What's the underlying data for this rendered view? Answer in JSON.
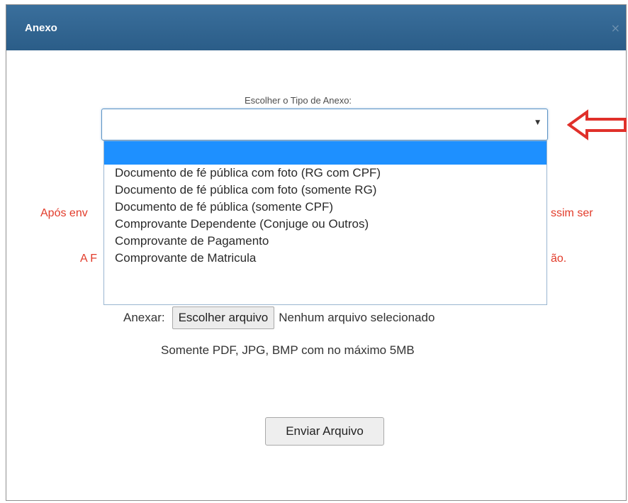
{
  "dialog": {
    "title": "Anexo",
    "close_glyph": "×",
    "close_icon": "close-icon"
  },
  "attachment_type": {
    "label": "Escolher o Tipo de Anexo:",
    "selected_value": "",
    "caret_glyph": "▼",
    "caret_icon": "chevron-down-icon",
    "options": [
      "",
      "Documento de fé pública com foto (RG com CPF)",
      "Documento de fé pública com foto (somente RG)",
      "Documento de fé pública (somente CPF)",
      "Comprovante Dependente (Conjuge ou Outros)",
      "Comprovante de Pagamento",
      "Comprovante de Matricula"
    ],
    "highlighted_option_index": 0
  },
  "annotation": {
    "arrow_icon": "left-arrow-icon",
    "arrow_color": "#e0302a"
  },
  "warnings": {
    "line1_start": "Após env",
    "line1_end": "ssim ser",
    "line2_start": "A F",
    "line2_end": "ão."
  },
  "file_upload": {
    "label": "Anexar:",
    "button_label": "Escolher arquivo",
    "status": "Nenhum arquivo selecionado",
    "note": "Somente PDF, JPG, BMP com no máximo 5MB"
  },
  "actions": {
    "send_label": "Enviar Arquivo"
  },
  "colors": {
    "titlebar": "#2f6391",
    "warning_text": "#e23b2a",
    "highlight": "#1e90ff"
  }
}
